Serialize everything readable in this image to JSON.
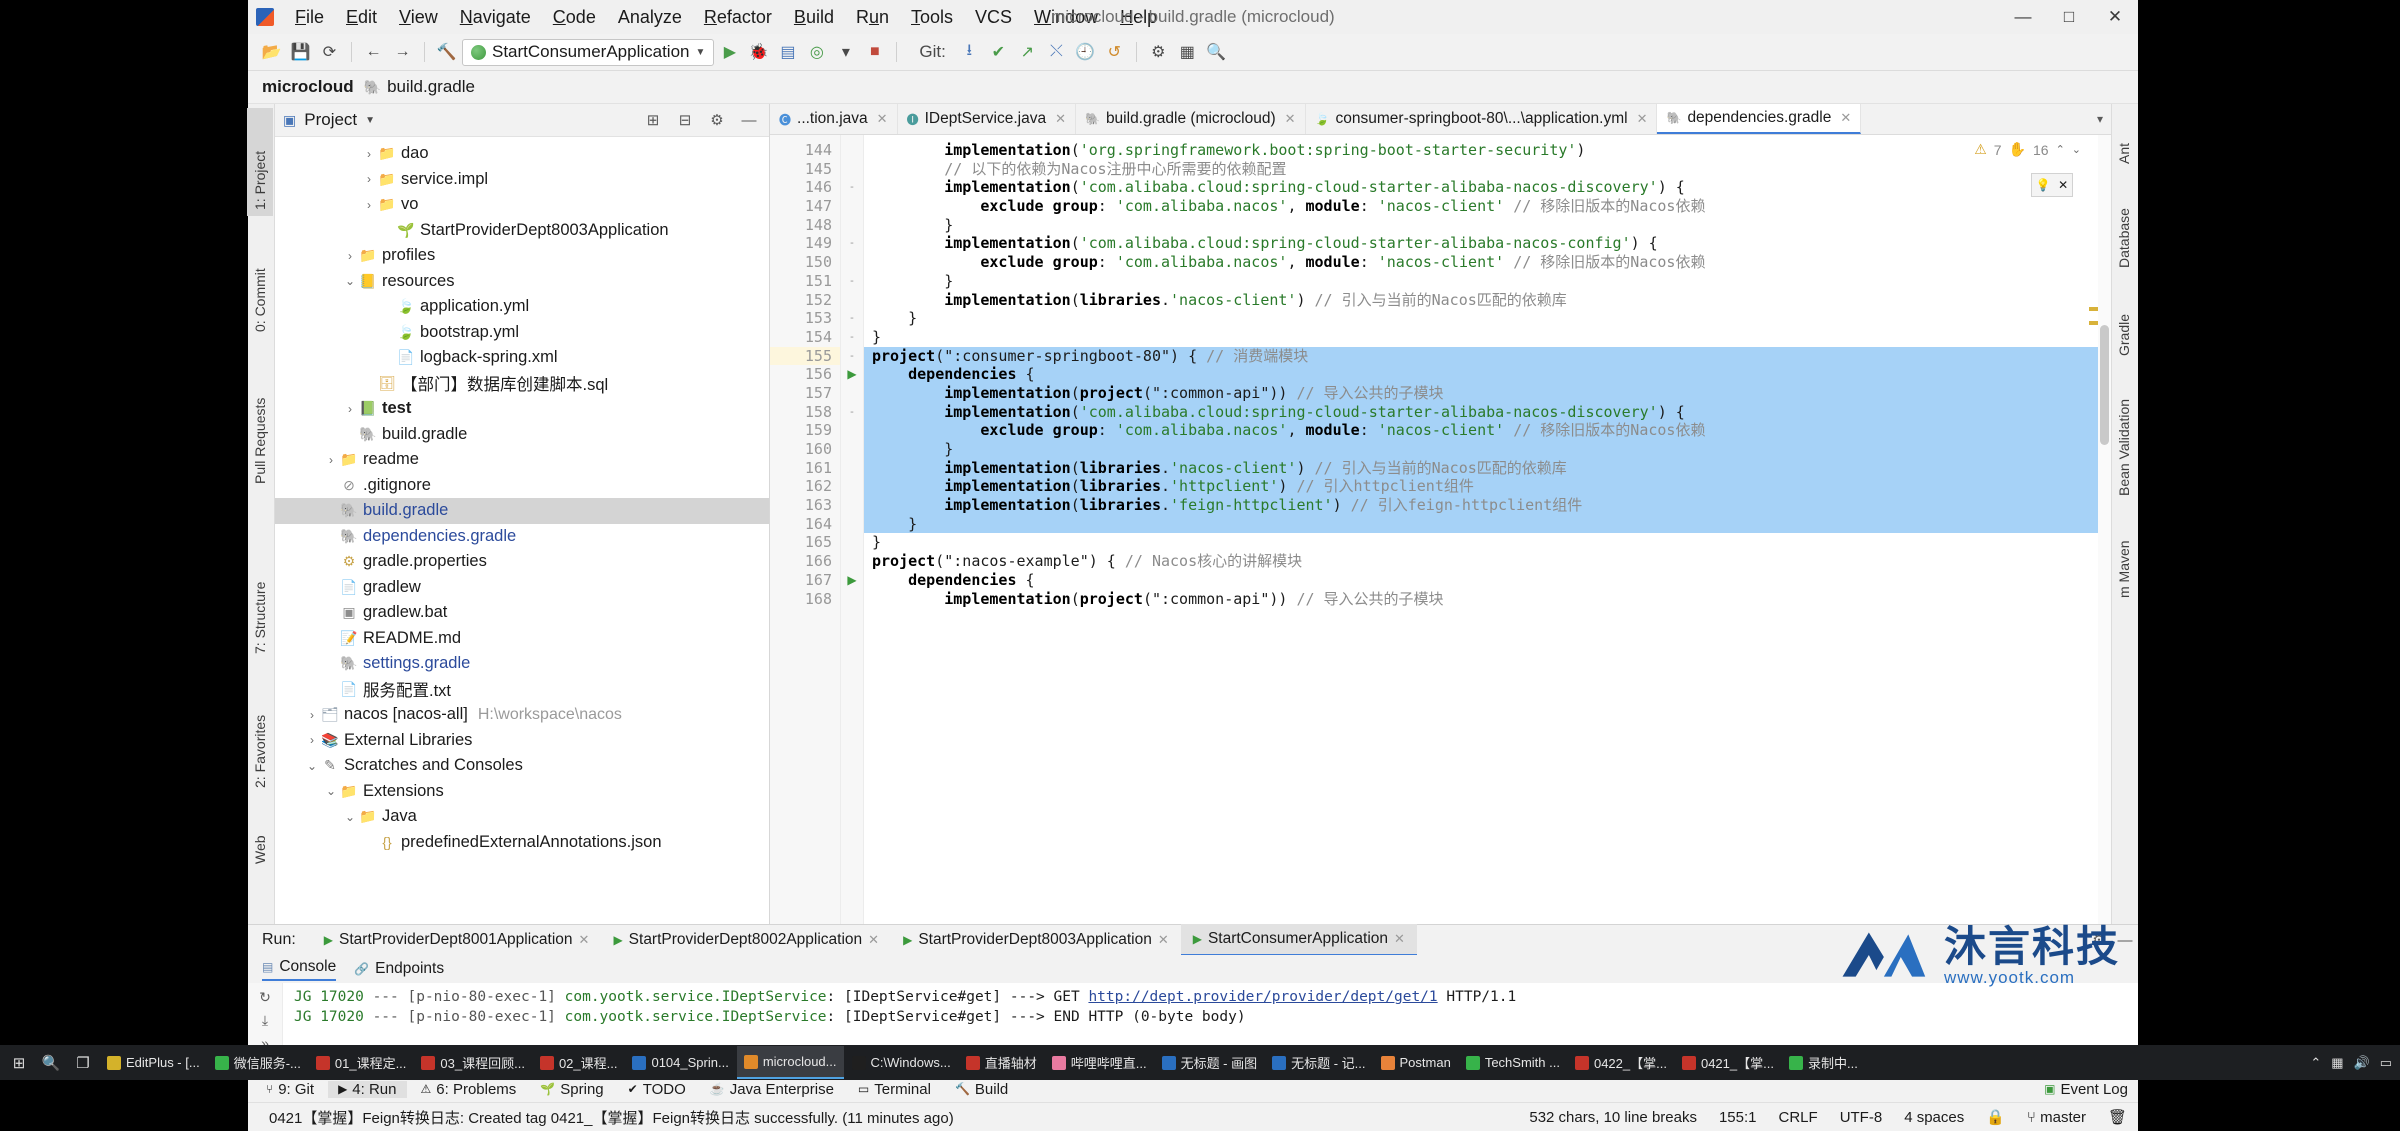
{
  "window": {
    "title": "microcloud - build.gradle (microcloud)",
    "minimize": "—",
    "maximize": "□",
    "close": "✕"
  },
  "menu": [
    "File",
    "Edit",
    "View",
    "Navigate",
    "Code",
    "Analyze",
    "Refactor",
    "Build",
    "Run",
    "Tools",
    "VCS",
    "Window",
    "Help"
  ],
  "toolbar": {
    "run_config": "StartConsumerApplication",
    "git_label": "Git:",
    "icons": [
      "open-folder-icon",
      "save-all-icon",
      "sync-icon",
      "back-icon",
      "forward-icon",
      "build-hammer-icon",
      "run-icon",
      "debug-icon",
      "run-coverage-icon",
      "profile-icon",
      "stop-icon",
      "update-project-icon",
      "commit-icon",
      "push-icon",
      "history-icon",
      "undo-icon",
      "settings-icon",
      "search-everywhere-icon"
    ]
  },
  "breadcrumb": {
    "project": "microcloud",
    "file": "build.gradle"
  },
  "left_strip": [
    {
      "label": "1: Project",
      "selected": true
    },
    {
      "label": "0: Commit",
      "selected": false
    },
    {
      "label": "Pull Requests",
      "selected": false
    },
    {
      "label": "7: Structure",
      "selected": false
    },
    {
      "label": "2: Favorites",
      "selected": false
    },
    {
      "label": "Web",
      "selected": false
    }
  ],
  "right_strip": [
    "Ant",
    "Database",
    "Gradle",
    "Bean Validation",
    "m Maven"
  ],
  "project_panel": {
    "title": "Project",
    "tree": [
      {
        "indent": 4,
        "arrow": "›",
        "icon": "folder-icon",
        "name": "dao",
        "style": "plain"
      },
      {
        "indent": 4,
        "arrow": "›",
        "icon": "folder-icon",
        "name": "service.impl",
        "style": "plain"
      },
      {
        "indent": 4,
        "arrow": "›",
        "icon": "folder-icon",
        "name": "vo",
        "style": "plain"
      },
      {
        "indent": 5,
        "arrow": "",
        "icon": "spring-class-icon",
        "name": "StartProviderDept8003Application",
        "style": "plain"
      },
      {
        "indent": 3,
        "arrow": "›",
        "icon": "folder-icon",
        "name": "profiles",
        "style": "plain"
      },
      {
        "indent": 3,
        "arrow": "⌄",
        "icon": "resources-folder-icon",
        "name": "resources",
        "style": "plain"
      },
      {
        "indent": 5,
        "arrow": "",
        "icon": "yml-spring-icon",
        "name": "application.yml",
        "style": "plain"
      },
      {
        "indent": 5,
        "arrow": "",
        "icon": "yml-icon",
        "name": "bootstrap.yml",
        "style": "plain"
      },
      {
        "indent": 5,
        "arrow": "",
        "icon": "xml-icon",
        "name": "logback-spring.xml",
        "style": "plain"
      },
      {
        "indent": 4,
        "arrow": "",
        "icon": "sql-icon",
        "name": "【部门】数据库创建脚本.sql",
        "style": "plain"
      },
      {
        "indent": 3,
        "arrow": "›",
        "icon": "test-folder-icon",
        "name": "test",
        "style": "bold"
      },
      {
        "indent": 3,
        "arrow": "",
        "icon": "gradle-icon",
        "name": "build.gradle",
        "style": "plain"
      },
      {
        "indent": 2,
        "arrow": "›",
        "icon": "folder-icon",
        "name": "readme",
        "style": "plain"
      },
      {
        "indent": 2,
        "arrow": "",
        "icon": "gitignore-icon",
        "name": ".gitignore",
        "style": "plain"
      },
      {
        "indent": 2,
        "arrow": "",
        "icon": "gradle-icon",
        "name": "build.gradle",
        "style": "selected"
      },
      {
        "indent": 2,
        "arrow": "",
        "icon": "gradle-icon",
        "name": "dependencies.gradle",
        "style": "link"
      },
      {
        "indent": 2,
        "arrow": "",
        "icon": "properties-icon",
        "name": "gradle.properties",
        "style": "plain"
      },
      {
        "indent": 2,
        "arrow": "",
        "icon": "file-icon",
        "name": "gradlew",
        "style": "plain"
      },
      {
        "indent": 2,
        "arrow": "",
        "icon": "bat-icon",
        "name": "gradlew.bat",
        "style": "plain"
      },
      {
        "indent": 2,
        "arrow": "",
        "icon": "md-icon",
        "name": "README.md",
        "style": "plain"
      },
      {
        "indent": 2,
        "arrow": "",
        "icon": "gradle-icon",
        "name": "settings.gradle",
        "style": "link"
      },
      {
        "indent": 2,
        "arrow": "",
        "icon": "txt-icon",
        "name": "服务配置.txt",
        "style": "plain"
      },
      {
        "indent": 1,
        "arrow": "›",
        "icon": "module-icon",
        "name": "nacos [nacos-all]",
        "style": "plain",
        "path": "H:\\workspace\\nacos"
      },
      {
        "indent": 1,
        "arrow": "›",
        "icon": "library-icon",
        "name": "External Libraries",
        "style": "plain"
      },
      {
        "indent": 1,
        "arrow": "⌄",
        "icon": "scratch-icon",
        "name": "Scratches and Consoles",
        "style": "plain"
      },
      {
        "indent": 2,
        "arrow": "⌄",
        "icon": "folder-icon",
        "name": "Extensions",
        "style": "plain"
      },
      {
        "indent": 3,
        "arrow": "⌄",
        "icon": "folder-icon",
        "name": "Java",
        "style": "plain"
      },
      {
        "indent": 4,
        "arrow": "",
        "icon": "json-icon",
        "name": "predefinedExternalAnnotations.json",
        "style": "plain"
      }
    ]
  },
  "editor_tabs": [
    {
      "label": "...tion.java",
      "icon": "java-class-icon",
      "active": false,
      "closable": true
    },
    {
      "label": "IDeptService.java",
      "icon": "java-interface-icon",
      "active": false,
      "closable": true
    },
    {
      "label": "build.gradle (microcloud)",
      "icon": "gradle-icon",
      "active": false,
      "closable": true
    },
    {
      "label": "consumer-springboot-80\\...\\application.yml",
      "icon": "yml-icon",
      "active": false,
      "closable": true
    },
    {
      "label": "dependencies.gradle",
      "icon": "gradle-icon",
      "active": true,
      "closable": true
    }
  ],
  "inspections": {
    "warnings": "7",
    "weak": "16",
    "caret_up": "⌃",
    "caret_down": "⌄"
  },
  "code": {
    "first_line": 144,
    "selection_start_line": 155,
    "selection_end_line": 164,
    "current_line": 155,
    "lines": [
      {
        "n": 144,
        "text": "        implementation('org.springframework.boot:spring-boot-starter-security')"
      },
      {
        "n": 145,
        "text": "        // 以下的依赖为Nacos注册中心所需要的依赖配置"
      },
      {
        "n": 146,
        "text": "        implementation('com.alibaba.cloud:spring-cloud-starter-alibaba-nacos-discovery') {",
        "fold": "-"
      },
      {
        "n": 147,
        "text": "            exclude group: 'com.alibaba.nacos', module: 'nacos-client' // 移除旧版本的Nacos依赖"
      },
      {
        "n": 148,
        "text": "        }"
      },
      {
        "n": 149,
        "text": "        implementation('com.alibaba.cloud:spring-cloud-starter-alibaba-nacos-config') {",
        "fold": "-"
      },
      {
        "n": 150,
        "text": "            exclude group: 'com.alibaba.nacos', module: 'nacos-client' // 移除旧版本的Nacos依赖"
      },
      {
        "n": 151,
        "text": "        }",
        "fold": "-"
      },
      {
        "n": 152,
        "text": "        implementation(libraries.'nacos-client') // 引入与当前的Nacos匹配的依赖库"
      },
      {
        "n": 153,
        "text": "    }",
        "fold": "-"
      },
      {
        "n": 154,
        "text": "}",
        "fold": "-"
      },
      {
        "n": 155,
        "text": "project(\":consumer-springboot-80\") { // 消费端模块",
        "fold": "-"
      },
      {
        "n": 156,
        "text": "    dependencies {",
        "fold": "▶"
      },
      {
        "n": 157,
        "text": "        implementation(project(\":common-api\")) // 导入公共的子模块"
      },
      {
        "n": 158,
        "text": "        implementation('com.alibaba.cloud:spring-cloud-starter-alibaba-nacos-discovery') {",
        "fold": "-"
      },
      {
        "n": 159,
        "text": "            exclude group: 'com.alibaba.nacos', module: 'nacos-client' // 移除旧版本的Nacos依赖"
      },
      {
        "n": 160,
        "text": "        }"
      },
      {
        "n": 161,
        "text": "        implementation(libraries.'nacos-client') // 引入与当前的Nacos匹配的依赖库"
      },
      {
        "n": 162,
        "text": "        implementation(libraries.'httpclient') // 引入httpclient组件"
      },
      {
        "n": 163,
        "text": "        implementation(libraries.'feign-httpclient') // 引入feign-httpclient组件"
      },
      {
        "n": 164,
        "text": "    }"
      },
      {
        "n": 165,
        "text": "}"
      },
      {
        "n": 166,
        "text": "project(\":nacos-example\") { // Nacos核心的讲解模块"
      },
      {
        "n": 167,
        "text": "    dependencies {",
        "fold": "▶"
      },
      {
        "n": 168,
        "text": "        implementation(project(\":common-api\")) // 导入公共的子模块"
      }
    ]
  },
  "run_window": {
    "label": "Run:",
    "tabs": [
      {
        "label": "StartProviderDept8001Application",
        "active": false
      },
      {
        "label": "StartProviderDept8002Application",
        "active": false
      },
      {
        "label": "StartProviderDept8003Application",
        "active": false
      },
      {
        "label": "StartConsumerApplication",
        "active": true
      }
    ],
    "sub_tabs": [
      {
        "label": "Console",
        "active": true,
        "icon": "console-icon"
      },
      {
        "label": "Endpoints",
        "active": false,
        "icon": "endpoints-icon"
      }
    ],
    "console_lines": [
      {
        "prefix": "JG 17020",
        "mid": "--- [p-nio-80-exec-1]",
        "cls": "com.yootk.service.IDeptService",
        "tail": ": [IDeptService#get] ---> GET ",
        "link": "http://dept.provider/provider/dept/get/1",
        "suffix": " HTTP/1.1"
      },
      {
        "prefix": "JG 17020",
        "mid": "--- [p-nio-80-exec-1]",
        "cls": "com.yootk.service.IDeptService",
        "tail": ": [IDeptService#get] ---> END HTTP (0-byte body)",
        "link": "",
        "suffix": ""
      }
    ]
  },
  "watermark": {
    "title": "沐言科技",
    "url": "www.yootk.com"
  },
  "bottom_bar": [
    {
      "label": "9: Git",
      "icon": "git-icon",
      "active": false
    },
    {
      "label": "4: Run",
      "icon": "run-icon",
      "active": true
    },
    {
      "label": "6: Problems",
      "icon": "problems-icon",
      "active": false
    },
    {
      "label": "Spring",
      "icon": "spring-icon",
      "active": false
    },
    {
      "label": "TODO",
      "icon": "todo-icon",
      "active": false
    },
    {
      "label": "Java Enterprise",
      "icon": "java-ee-icon",
      "active": false
    },
    {
      "label": "Terminal",
      "icon": "terminal-icon",
      "active": false
    },
    {
      "label": "Build",
      "icon": "build-icon",
      "active": false
    }
  ],
  "bottom_bar_right": {
    "label": "Event Log",
    "icon": "event-log-icon"
  },
  "status_bar": {
    "message": "0421【掌握】Feign转换日志: Created tag 0421_【掌握】Feign转换日志 successfully. (11 minutes ago)",
    "chars": "532 chars, 10 line breaks",
    "caret": "155:1",
    "line_sep": "CRLF",
    "encoding": "UTF-8",
    "indent": "4 spaces",
    "branch": "master",
    "lock_icon": "lock-icon",
    "branch_icon": "branch-icon"
  },
  "taskbar": {
    "start": "start-icon",
    "search": "search-icon",
    "task_view": "task-view-icon",
    "items": [
      {
        "label": "EditPlus - [...",
        "color": "#d4b22a"
      },
      {
        "label": "微信服务-...",
        "color": "#37b34a"
      },
      {
        "label": "01_课程定...",
        "color": "#c5342a"
      },
      {
        "label": "03_课程回顾...",
        "color": "#c5342a"
      },
      {
        "label": "02_课程...",
        "color": "#c5342a"
      },
      {
        "label": "0104_Sprin...",
        "color": "#2a6fc0"
      },
      {
        "label": "microcloud...",
        "color": "#e08a2a",
        "active": true
      },
      {
        "label": "C:\\Windows...",
        "color": "#1f1f1f"
      },
      {
        "label": "直播轴材",
        "color": "#c5342a"
      },
      {
        "label": "哔哩哔哩直...",
        "color": "#e87aa0"
      },
      {
        "label": "无标题 - 画图",
        "color": "#2a6fc0"
      },
      {
        "label": "无标题 - 记...",
        "color": "#2a6fc0"
      },
      {
        "label": "Postman",
        "color": "#e8833a"
      },
      {
        "label": "TechSmith ...",
        "color": "#37b34a"
      },
      {
        "label": "0422_【掌...",
        "color": "#c5342a"
      },
      {
        "label": "0421_【掌...",
        "color": "#c5342a"
      },
      {
        "label": "录制中...",
        "color": "#37b34a"
      }
    ]
  }
}
